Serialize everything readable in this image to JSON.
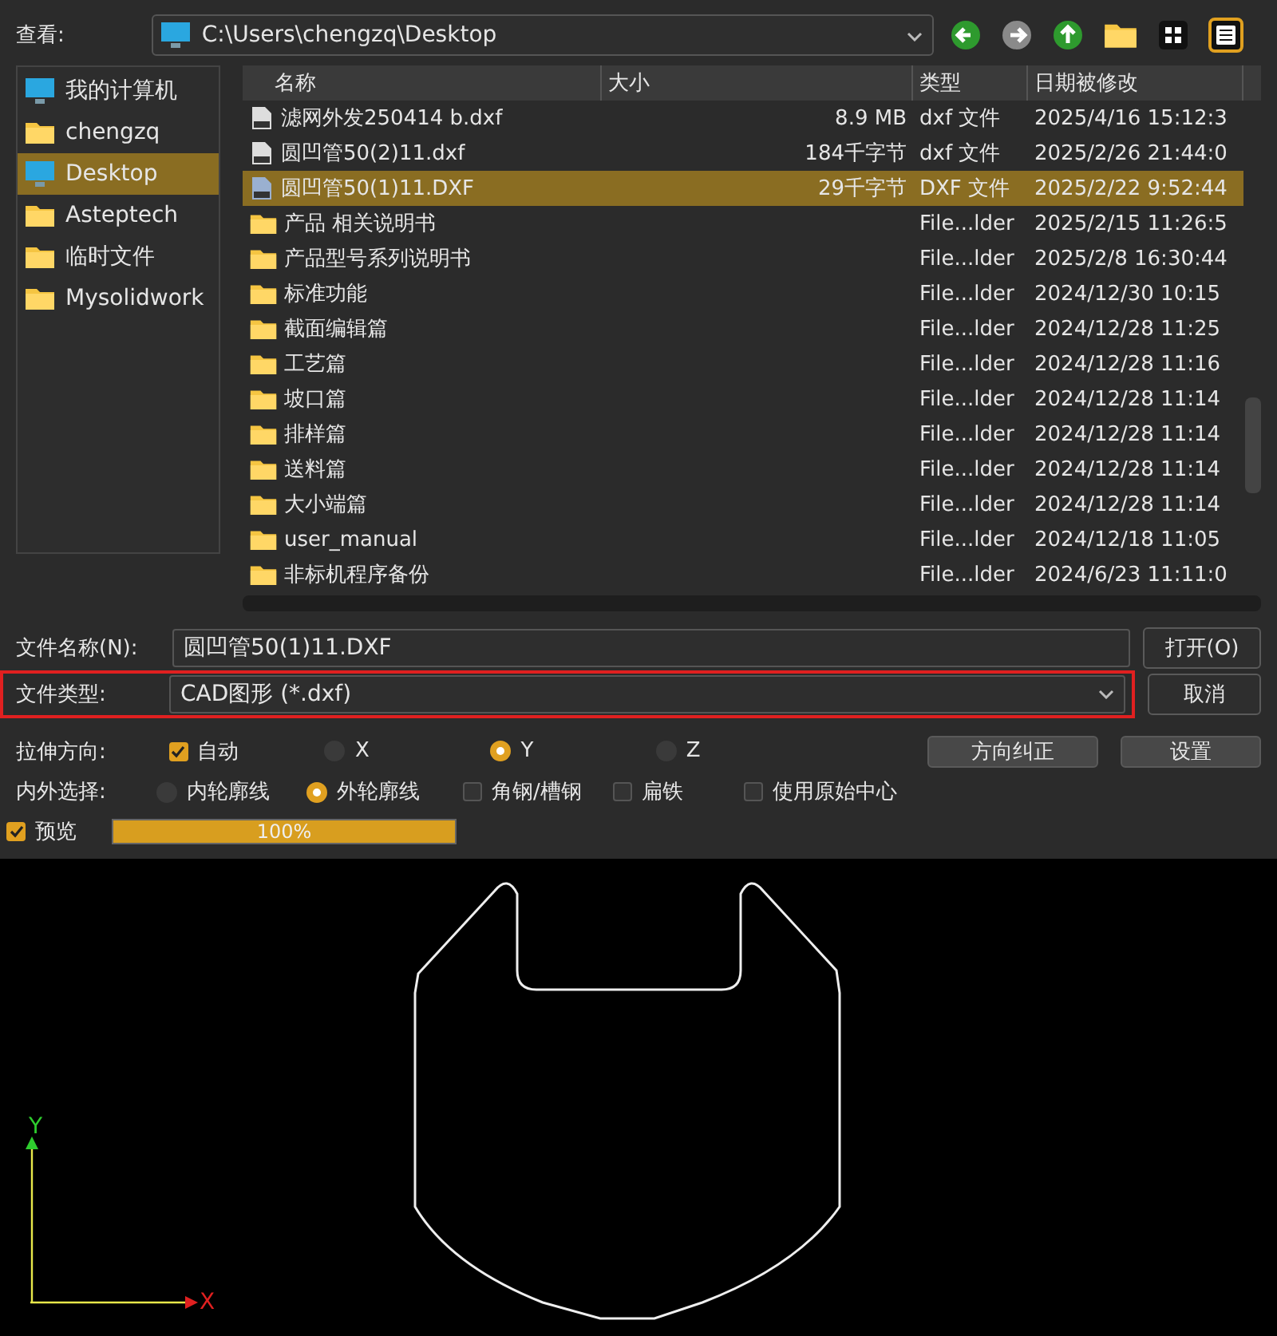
{
  "look_in": {
    "label": "查看:",
    "path": "C:\\Users\\chengzq\\Desktop"
  },
  "sidebar": {
    "items": [
      {
        "label": "我的计算机",
        "kind": "computer",
        "selected": false
      },
      {
        "label": "chengzq",
        "kind": "folder",
        "selected": false
      },
      {
        "label": "Desktop",
        "kind": "desktop",
        "selected": true
      },
      {
        "label": "Asteptech",
        "kind": "folder",
        "selected": false
      },
      {
        "label": "临时文件",
        "kind": "folder",
        "selected": false
      },
      {
        "label": "Mysolidwork",
        "kind": "folder",
        "selected": false
      }
    ]
  },
  "file_list": {
    "columns": [
      "名称",
      "大小",
      "类型",
      "日期被修改"
    ],
    "rows": [
      {
        "name": "滤网外发250414 b.dxf",
        "size": "8.9 MB",
        "type": "dxf 文件",
        "date": "2025/4/16 15:12:3",
        "kind": "dxf",
        "selected": false
      },
      {
        "name": "圆凹管50(2)11.dxf",
        "size": "184千字节",
        "type": "dxf 文件",
        "date": "2025/2/26 21:44:0",
        "kind": "dxf",
        "selected": false
      },
      {
        "name": "圆凹管50(1)11.DXF",
        "size": "29千字节",
        "type": "DXF 文件",
        "date": "2025/2/22 9:52:44",
        "kind": "dxf",
        "selected": true
      },
      {
        "name": "产品 相关说明书",
        "size": "",
        "type": "File...lder",
        "date": "2025/2/15 11:26:5",
        "kind": "folder",
        "selected": false
      },
      {
        "name": "产品型号系列说明书",
        "size": "",
        "type": "File...lder",
        "date": "2025/2/8 16:30:44",
        "kind": "folder",
        "selected": false
      },
      {
        "name": "标准功能",
        "size": "",
        "type": "File...lder",
        "date": "2024/12/30 10:15",
        "kind": "folder",
        "selected": false
      },
      {
        "name": "截面编辑篇",
        "size": "",
        "type": "File...lder",
        "date": "2024/12/28 11:25",
        "kind": "folder",
        "selected": false
      },
      {
        "name": "工艺篇",
        "size": "",
        "type": "File...lder",
        "date": "2024/12/28 11:16",
        "kind": "folder",
        "selected": false
      },
      {
        "name": "坡口篇",
        "size": "",
        "type": "File...lder",
        "date": "2024/12/28 11:14",
        "kind": "folder",
        "selected": false
      },
      {
        "name": "排样篇",
        "size": "",
        "type": "File...lder",
        "date": "2024/12/28 11:14",
        "kind": "folder",
        "selected": false
      },
      {
        "name": "送料篇",
        "size": "",
        "type": "File...lder",
        "date": "2024/12/28 11:14",
        "kind": "folder",
        "selected": false
      },
      {
        "name": "大小端篇",
        "size": "",
        "type": "File...lder",
        "date": "2024/12/28 11:14",
        "kind": "folder",
        "selected": false
      },
      {
        "name": "user_manual",
        "size": "",
        "type": "File...lder",
        "date": "2024/12/18 11:05",
        "kind": "folder",
        "selected": false
      },
      {
        "name": "非标机程序备份",
        "size": "",
        "type": "File...lder",
        "date": "2024/6/23 11:11:0",
        "kind": "folder",
        "selected": false
      }
    ]
  },
  "file_name": {
    "label": "文件名称(N):",
    "value": "圆凹管50(1)11.DXF",
    "button": "打开(O)"
  },
  "file_type": {
    "label": "文件类型:",
    "value": "CAD图形 (*.dxf)",
    "button": "取消",
    "highlighted": true
  },
  "stretch": {
    "label": "拉伸方向:",
    "options": [
      {
        "kind": "checkbox",
        "label": "自动",
        "checked": true
      },
      {
        "kind": "radio",
        "label": "X",
        "selected": false
      },
      {
        "kind": "radio",
        "label": "Y",
        "selected": true
      },
      {
        "kind": "radio",
        "label": "Z",
        "selected": false
      }
    ],
    "buttons": [
      "方向纠正",
      "设置"
    ]
  },
  "contour": {
    "label": "内外选择:",
    "options": [
      {
        "kind": "radio",
        "label": "内轮廓线",
        "selected": false
      },
      {
        "kind": "radio",
        "label": "外轮廓线",
        "selected": true
      },
      {
        "kind": "checkbox",
        "label": "角钢/槽钢",
        "checked": false
      },
      {
        "kind": "checkbox",
        "label": "扁铁",
        "checked": false
      },
      {
        "kind": "checkbox",
        "label": "使用原始中心",
        "checked": false
      }
    ]
  },
  "preview": {
    "label": "预览",
    "checked": true,
    "level": 1,
    "reading": "100%"
  },
  "axes": {
    "x": "X",
    "y": "Y"
  }
}
